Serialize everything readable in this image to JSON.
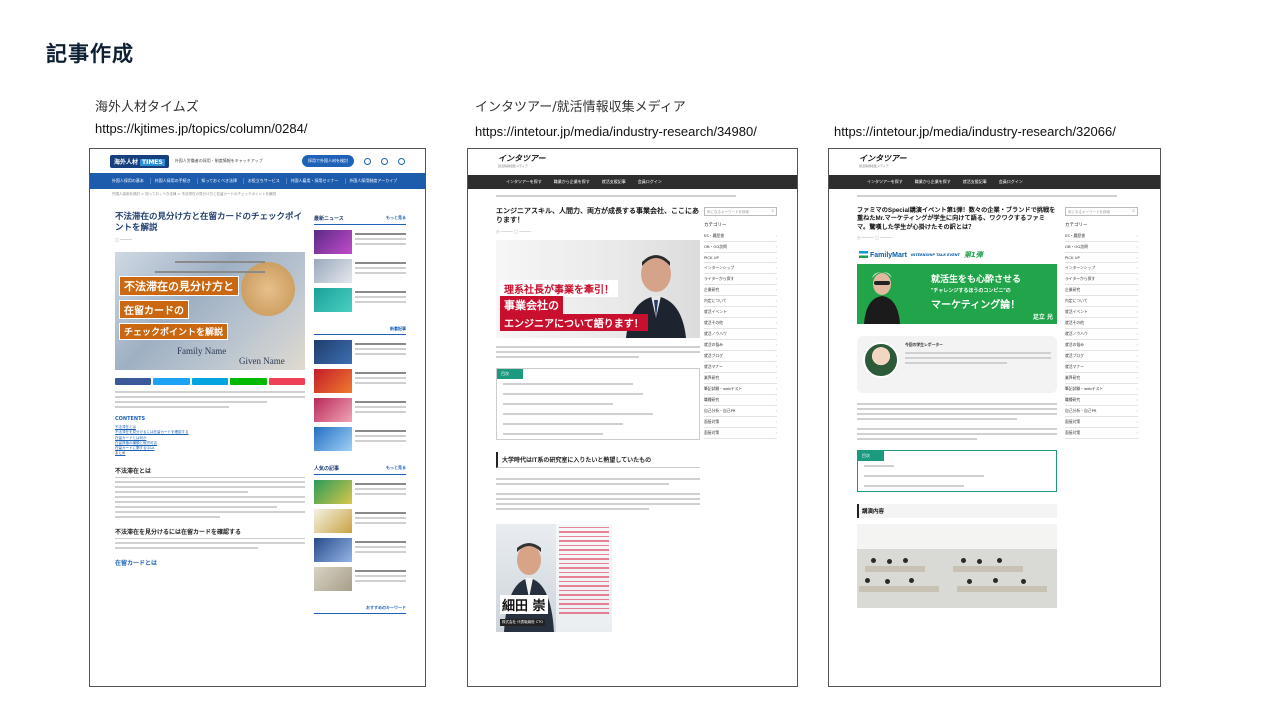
{
  "slide": {
    "title": "記事作成"
  },
  "references": [
    {
      "name": "海外人材タイムズ",
      "url": "https://kjtimes.jp/topics/column/0284/"
    },
    {
      "name": "インタツアー/就活情報収集メディア",
      "url": "https://intetour.jp/media/industry-research/34980/"
    },
    {
      "name": "",
      "url": "https://intetour.jp/media/industry-research/32066/"
    }
  ],
  "site1": {
    "logo_main": "海外人材",
    "logo_badge": "TIMES",
    "tagline": "外国人労働者の採用・制度情報をキャッチアップ",
    "cta": "採用で外国人材を検討",
    "nav": [
      "外国人採用の基本",
      "外国人採用の手続き",
      "知っておくべき法律",
      "お役立ちサービス",
      "外国人雇用・採用セミナー",
      "外国人採用制度アーカイブ"
    ],
    "breadcrumb": "外国人採用を検討 > 知っておくべき法律 > 不法滞在の見分け方と在留カードのチェックポイントを解説",
    "article_title": "不法滞在の見分け方と在留カードのチェックポイントを解説",
    "hero_lines": [
      "不法滞在の見分け方と",
      "在留カードの",
      "チェックポイントを解説"
    ],
    "hero_sub": [
      "Family Name",
      "Given Name"
    ],
    "contents_label": "CONTENTS",
    "toc": [
      "不法滞在とは",
      "不法滞在を見分けるには在留カードを確認する",
      "在留カードとは何か",
      "在留資格の種類と就労可否",
      "在留カードに関するQ&A",
      "まとめ"
    ],
    "section_1": "不法滞在とは",
    "section_2": "不法滞在を見分けるには在留カードを確認する",
    "section_3": "在留カードとは",
    "side_news_title": "最新ニュース",
    "side_new_articles": "新着記事",
    "side_popular": "人気の記事",
    "side_keywords": "おすすめのキーワード",
    "more": "もっと見る"
  },
  "site2": {
    "logo": "インタツアー",
    "tagline": "就活情報収集メディア",
    "nav": [
      "インタツアーを探す",
      "職業から企業を探す",
      "就活支援記事",
      "会員ログイン"
    ],
    "article_title": "エンジニアスキル、人間力、両方が成長する事業会社、ここにあります！",
    "hero_lines": [
      "理系社長が事業を牽引！",
      "事業会社の",
      "エンジニアについて語ります！"
    ],
    "toc_label": "目次",
    "h2": "大学時代はIT系の研究室に入りたいと熱望していたもの",
    "name_overlay": "細田 崇",
    "role_overlay": "株式会社 代表取締役 CTO",
    "search_placeholder": "気になるキーワードを検索"
  },
  "site3": {
    "logo": "インタツアー",
    "article_title": "ファミマのSpecial講演イベント第1弾！数々の企業・ブランドで挑戦を重ねたMr.マーケティングが学生に向けて語る、ワクワクするファミマ。驚嘆した学生が心掛けたその訳とは？",
    "fm_brand": "FamilyMart",
    "fm_event": "INTERNSHIP TALK EVENT",
    "fm_round": "第1弾",
    "fm_lines": [
      "就活生をも心酔させる",
      "\"チャレンジするほうのコンビニ\"の",
      "マーケティング論！"
    ],
    "fm_speaker": "足立 光",
    "reporter_title": "今回の学生レポーター",
    "toc_label": "目次",
    "h2": "講演内容",
    "categories_label": "カテゴリー",
    "categories": [
      "ES・履歴書",
      "OB・OG訪問",
      "PICK UP",
      "インターンシップ",
      "ライターから探す",
      "企業研究",
      "内定について",
      "就活イベント",
      "就活その他",
      "就活ノウハウ",
      "就活の悩み",
      "就活ブログ",
      "就活マナー",
      "業界研究",
      "筆記試験・webテスト",
      "職種研究",
      "自己分析・自己PR",
      "面接対策",
      "面接対策"
    ]
  }
}
